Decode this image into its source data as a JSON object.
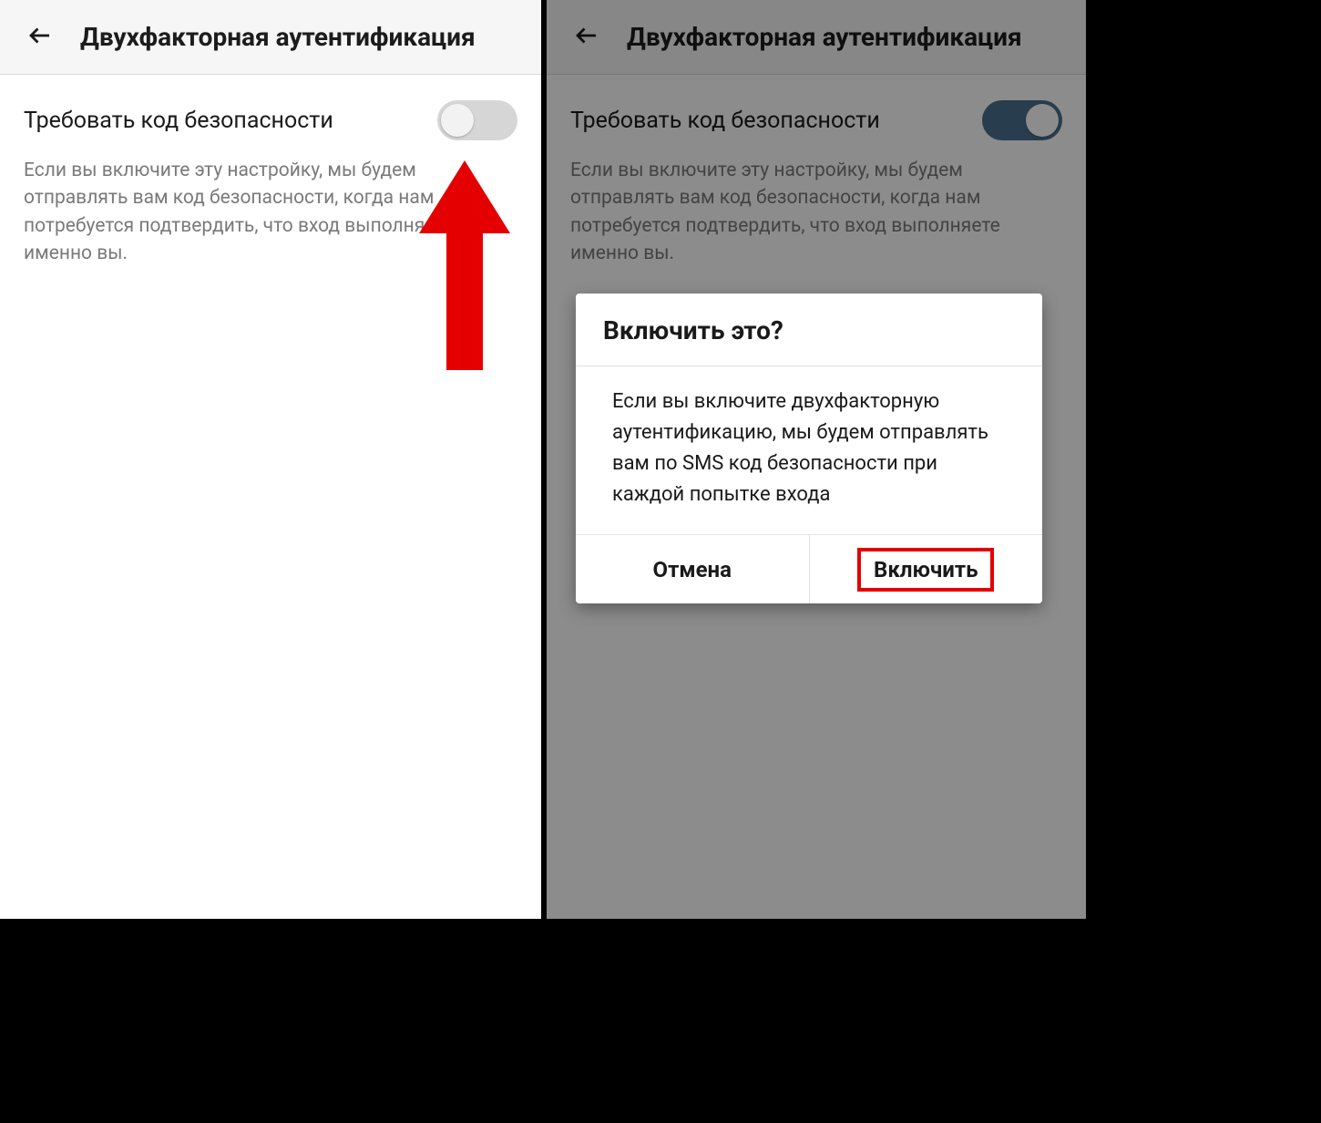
{
  "left": {
    "header_title": "Двухфакторная аутентификация",
    "toggle_label": "Требовать код безопасности",
    "toggle_on": false,
    "description": "Если вы включите эту настройку, мы будем отправлять вам код безопасности, когда нам потребуется подтвердить, что вход выполняете именно вы."
  },
  "right": {
    "header_title": "Двухфакторная аутентификация",
    "toggle_label": "Требовать код безопасности",
    "toggle_on": true,
    "description": "Если вы включите эту настройку, мы будем отправлять вам код безопасности, когда нам потребуется подтвердить, что вход выполняете именно вы.",
    "dialog": {
      "title": "Включить это?",
      "body": "Если вы включите двухфакторную аутентификацию, мы будем отправлять вам по SMS код безопасности при каждой попытке входа",
      "cancel": "Отмена",
      "confirm": "Включить"
    }
  },
  "annotation": {
    "arrow_color": "#e40000",
    "highlight_color": "#e40000"
  }
}
